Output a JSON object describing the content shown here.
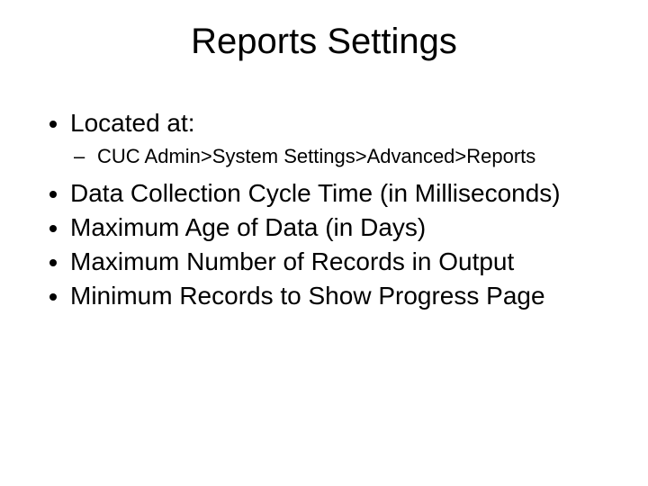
{
  "title": "Reports Settings",
  "located_label": "Located at:",
  "located_path": "CUC Admin>System Settings>Advanced>Reports",
  "bullets": {
    "b1": "Data Collection Cycle Time (in Milliseconds)",
    "b2": "Maximum Age of Data (in Days)",
    "b3": "Maximum Number of Records in Output",
    "b4": "Minimum Records to Show Progress Page"
  }
}
